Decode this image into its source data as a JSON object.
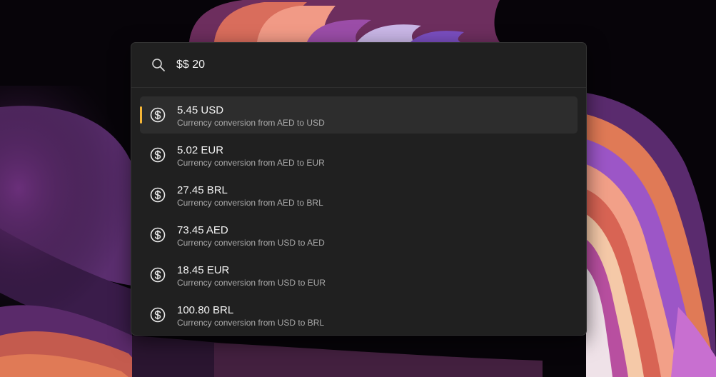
{
  "search": {
    "query": "$$ 20",
    "icon": "search-icon"
  },
  "results": [
    {
      "title": "5.45 USD",
      "subtitle": "Currency conversion from AED to USD",
      "icon": "currency-icon",
      "selected": true
    },
    {
      "title": "5.02 EUR",
      "subtitle": "Currency conversion from AED to EUR",
      "icon": "currency-icon",
      "selected": false
    },
    {
      "title": "27.45 BRL",
      "subtitle": "Currency conversion from AED to BRL",
      "icon": "currency-icon",
      "selected": false
    },
    {
      "title": "73.45 AED",
      "subtitle": "Currency conversion from USD to AED",
      "icon": "currency-icon",
      "selected": false
    },
    {
      "title": "18.45 EUR",
      "subtitle": "Currency conversion from USD to EUR",
      "icon": "currency-icon",
      "selected": false
    },
    {
      "title": "100.80 BRL",
      "subtitle": "Currency conversion from USD to BRL",
      "icon": "currency-icon",
      "selected": false
    }
  ],
  "colors": {
    "accent": "#f6b637",
    "panel_background": "#202020",
    "selected_row": "#2d2d2d"
  }
}
